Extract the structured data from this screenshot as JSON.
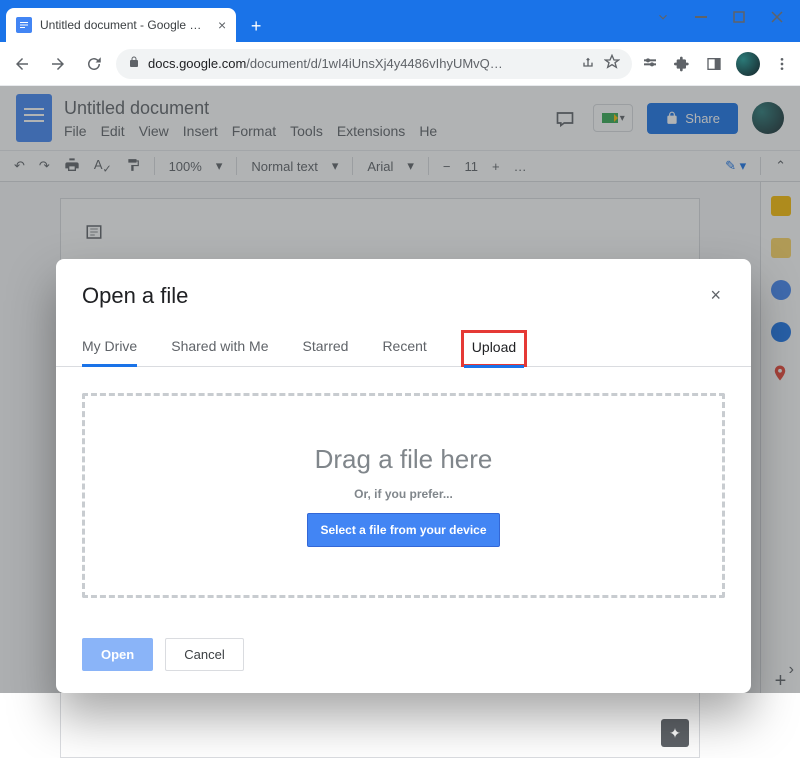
{
  "browser": {
    "tab_title": "Untitled document - Google Doc",
    "url_host": "docs.google.com",
    "url_path": "/document/d/1wI4iUnsXj4y4486vIhyUMvQ…"
  },
  "docs": {
    "title": "Untitled document",
    "menus": [
      "File",
      "Edit",
      "View",
      "Insert",
      "Format",
      "Tools",
      "Extensions",
      "He"
    ],
    "share_label": "Share",
    "toolbar": {
      "zoom": "100%",
      "style": "Normal text",
      "font": "Arial",
      "size": "11"
    }
  },
  "dialog": {
    "title": "Open a file",
    "tabs": [
      "My Drive",
      "Shared with Me",
      "Starred",
      "Recent",
      "Upload"
    ],
    "drop_heading": "Drag a file here",
    "drop_sub": "Or, if you prefer...",
    "select_label": "Select a file from your device",
    "open_label": "Open",
    "cancel_label": "Cancel"
  }
}
